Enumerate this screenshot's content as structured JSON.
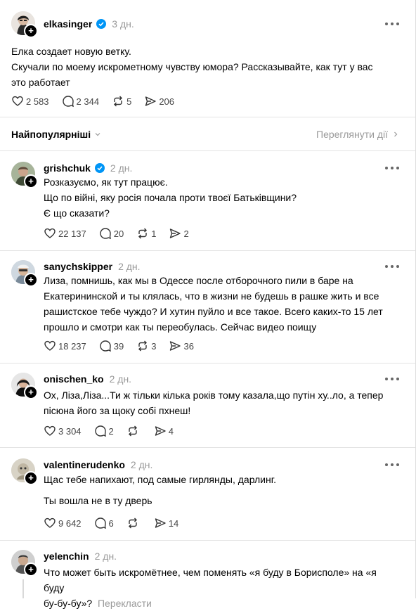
{
  "main_post": {
    "username": "elkasinger",
    "verified": true,
    "time": "3 дн.",
    "lines": [
      "Елка создает новую ветку.",
      "Скучали по моему искрометному чувству юмора? Рассказывайте, как тут у вас",
      "это работает"
    ],
    "likes": "2 583",
    "comments": "2 344",
    "reposts": "5",
    "shares": "206"
  },
  "sort": {
    "label": "Найпопулярніші",
    "activity_label": "Переглянути дії"
  },
  "replies": [
    {
      "username": "grishchuk",
      "verified": true,
      "time": "2 дн.",
      "lines": [
        "Розказуємо, як тут працює.",
        "Що по війні, яку росія почала проти твоєї Батьківщини?",
        "Є що сказати?"
      ],
      "likes": "22 137",
      "comments": "20",
      "reposts": "1",
      "shares": "2"
    },
    {
      "username": "sanychskipper",
      "verified": false,
      "time": "2 дн.",
      "lines": [
        "Лиза, помнишь, как мы в Одессе после отборочного пили в баре на",
        "Екатерининской и ты клялась, что в жизни не будешь в рашке жить и все",
        "рашистское тебе чуждо? И хутин пуйло и все такое. Всего каких-то 15 лет",
        "прошло и смотри как ты переобулась. Сейчас видео поищу"
      ],
      "likes": "18 237",
      "comments": "39",
      "reposts": "3",
      "shares": "36"
    },
    {
      "username": "onischen_ko",
      "verified": false,
      "time": "2 дн.",
      "lines": [
        "Ох, Ліза,Ліза...Ти ж тільки кілька років тому казала,що путін ху..ло, а тепер",
        "пісюна його за щоку собі пхнеш!"
      ],
      "likes": "3 304",
      "comments": "2",
      "reposts": "",
      "shares": "4"
    },
    {
      "username": "valentinerudenko",
      "verified": false,
      "time": "2 дн.",
      "lines": [
        "Щас тебе напихают, под самые гирлянды, дарлинг.",
        "Ты вошла не в ту дверь"
      ],
      "likes": "9 642",
      "comments": "6",
      "reposts": "",
      "shares": "14"
    },
    {
      "username": "yelenchin",
      "verified": false,
      "time": "2 дн.",
      "lines": [
        "Что может быть искромётнее, чем поменять «я буду в Борисполе» на «я буду",
        "бу-бу-бу»?"
      ],
      "translate_label": "Перекласти"
    }
  ],
  "colors": {
    "verified_blue": "#0095f6",
    "muted_text": "#999999",
    "separator": "#e3e3e3"
  }
}
